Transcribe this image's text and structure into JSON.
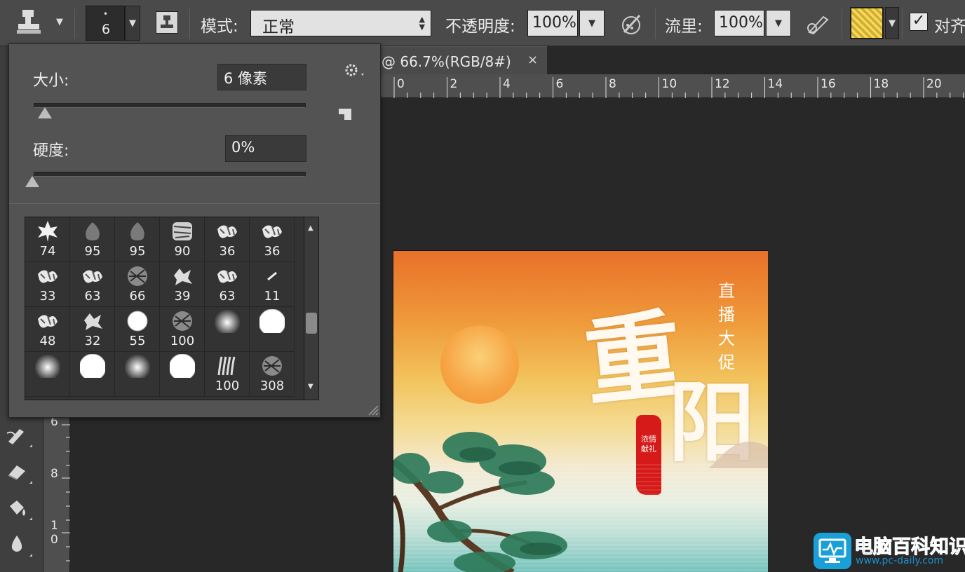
{
  "options_bar": {
    "brush_size_value": "6",
    "mode_label": "模式:",
    "mode_value": "正常",
    "opacity_label": "不透明度:",
    "opacity_value": "100%",
    "flow_label": "流里:",
    "flow_value": "100%",
    "align_label": "对齐",
    "pattern_swatch_color": "#e2c233",
    "icons": [
      "clone-stamp-icon",
      "brush-preset-icon",
      "toggle-clone-source-icon",
      "pressure-opacity-icon",
      "airbrush-icon",
      "pattern-swatch-icon"
    ]
  },
  "brush_popup": {
    "size_label": "大小:",
    "size_value": "6 像素",
    "hardness_label": "硬度:",
    "hardness_value": "0%",
    "size_slider_fraction": 0.02,
    "hardness_slider_fraction": 0.0,
    "gear_icon": "gear-icon",
    "new_preset_icon": "new-preset-icon",
    "brushes": [
      {
        "size": "74",
        "shape": "maple-leaf"
      },
      {
        "size": "95",
        "shape": "leaf"
      },
      {
        "size": "95",
        "shape": "leaf"
      },
      {
        "size": "90",
        "shape": "scatter-textured"
      },
      {
        "size": "36",
        "shape": "grass-scatter"
      },
      {
        "size": "36",
        "shape": "grass-scatter"
      },
      {
        "size": "33",
        "shape": "grass-scatter"
      },
      {
        "size": "63",
        "shape": "grass-scatter"
      },
      {
        "size": "66",
        "shape": "textured"
      },
      {
        "size": "39",
        "shape": "splatter"
      },
      {
        "size": "63",
        "shape": "grass-scatter"
      },
      {
        "size": "11",
        "shape": "dash"
      },
      {
        "size": "48",
        "shape": "grass-scatter"
      },
      {
        "size": "32",
        "shape": "splatter"
      },
      {
        "size": "55",
        "shape": "hard-round"
      },
      {
        "size": "100",
        "shape": "textured"
      },
      {
        "size": "",
        "shape": "soft-round"
      },
      {
        "size": "",
        "shape": "hard-round-large"
      },
      {
        "size": "",
        "shape": "soft-round"
      },
      {
        "size": "",
        "shape": "hard-round-large"
      },
      {
        "size": "",
        "shape": "soft-round"
      },
      {
        "size": "",
        "shape": "hard-round-large"
      },
      {
        "size": "100",
        "shape": "bristle"
      },
      {
        "size": "308",
        "shape": "textured"
      }
    ]
  },
  "document": {
    "tab_title": "@ 66.7%(RGB/8#)",
    "close_symbol": "×",
    "ruler_top_labels": [
      "0",
      "2",
      "4",
      "6",
      "8",
      "10",
      "12",
      "14",
      "16",
      "18",
      "20"
    ],
    "ruler_left_labels": [
      "6",
      "8",
      "1\n0"
    ]
  },
  "artwork": {
    "title_char_1": "重",
    "title_char_2": "阳",
    "side_text": "直播大促",
    "red_banner_text": "浓情献礼"
  },
  "watermark": {
    "text": "电脑百科知识",
    "url": "www.pc-daily.com"
  },
  "tools": {
    "icons": [
      "smudge-brush-icon",
      "eraser-icon",
      "paint-bucket-icon",
      "blur-drop-icon"
    ]
  }
}
